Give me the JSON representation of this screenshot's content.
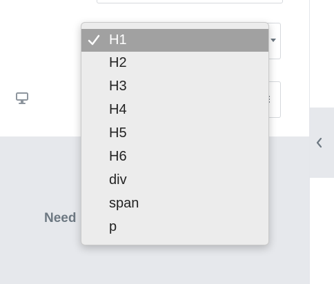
{
  "editor": {
    "background_text": "Need",
    "icons": {
      "responsive": "desktop-monitor-icon",
      "select_arrow": "caret-down-icon",
      "alignment": "vertical-dots-icon",
      "collapse": "chevron-left-icon",
      "selected_mark": "check-icon"
    },
    "colors": {
      "panel": "#ffffff",
      "grey_area": "#e6e8ec",
      "muted_text": "#6d7882",
      "dropdown_background": "#ececec",
      "selected_background": "#a1a1a1"
    }
  },
  "dropdown": {
    "selected": "H1",
    "options": [
      "H1",
      "H2",
      "H3",
      "H4",
      "H5",
      "H6",
      "div",
      "span",
      "p"
    ]
  }
}
